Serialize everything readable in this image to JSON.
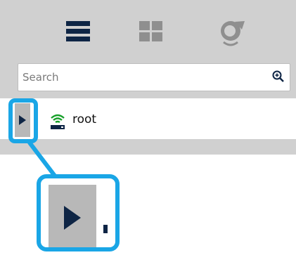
{
  "toolbar": {
    "buttons": [
      {
        "icon": "list-view-icon"
      },
      {
        "icon": "grid-view-icon"
      },
      {
        "icon": "refresh-icon"
      }
    ]
  },
  "search": {
    "placeholder": "Search",
    "value": "",
    "button_icon": "zoom-in-icon"
  },
  "tree": {
    "nodes": [
      {
        "label": "root",
        "icon": "wireless-router-icon",
        "expander_icon": "caret-right-icon"
      }
    ]
  },
  "annotation": {
    "highlight_color": "#1aa6e6",
    "target": "tree-expander"
  },
  "colors": {
    "panel_bg": "#d0d0d0",
    "icon_dark": "#0e2545",
    "icon_gray": "#8f8f8f",
    "node_icon_green": "#17a02a",
    "expander_bg": "#b8b8b8"
  }
}
